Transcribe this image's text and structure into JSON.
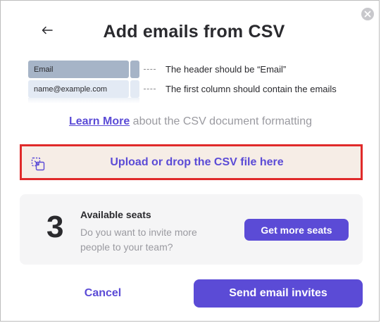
{
  "dialog": {
    "title": "Add emails from CSV"
  },
  "csv_example": {
    "header_cell": "Email",
    "row_cell": "name@example.com",
    "header_note": "The header should be “Email”",
    "row_note": "The first column should contain the emails"
  },
  "learn_more": {
    "link_label": "Learn More",
    "suffix": " about the CSV document formatting"
  },
  "upload": {
    "label": "Upload or drop the CSV file here"
  },
  "seats": {
    "count": "3",
    "title": "Available seats",
    "description": "Do you want to invite more people to your team?",
    "button_label": "Get more seats"
  },
  "footer": {
    "cancel_label": "Cancel",
    "send_label": "Send email invites"
  },
  "colors": {
    "accent": "#5b4bd6",
    "upload_bg": "#f6ede6",
    "highlight_border": "#e02a2a"
  },
  "icons": {
    "close": "close-icon",
    "back": "arrow-left-icon",
    "upload": "file-upload-icon"
  }
}
